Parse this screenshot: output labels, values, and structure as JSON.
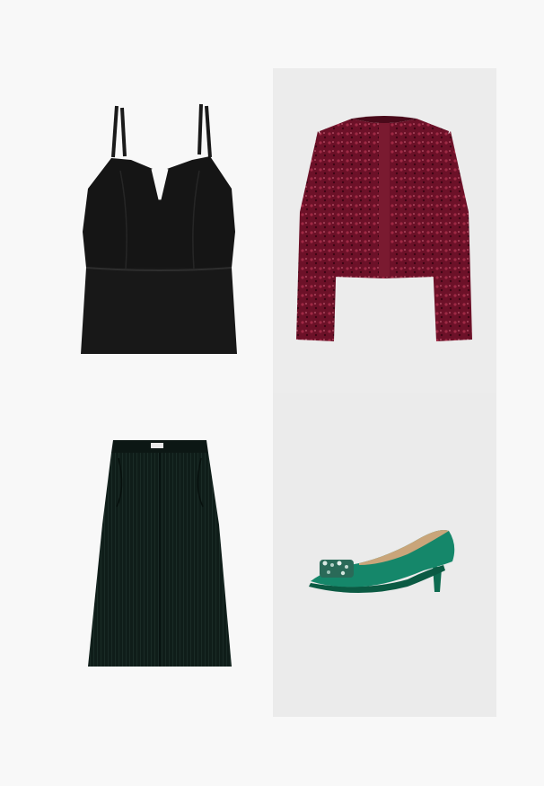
{
  "items": [
    {
      "id": "top",
      "garment": "camisole-top",
      "color": "#141414"
    },
    {
      "id": "jacket",
      "garment": "sequin-cropped-jacket",
      "color": "#6a1228"
    },
    {
      "id": "skirt",
      "garment": "corduroy-midi-skirt",
      "color": "#0d1a17"
    },
    {
      "id": "shoe",
      "garment": "embellished-kitten-heel-pump",
      "color": "#127a5c"
    }
  ]
}
